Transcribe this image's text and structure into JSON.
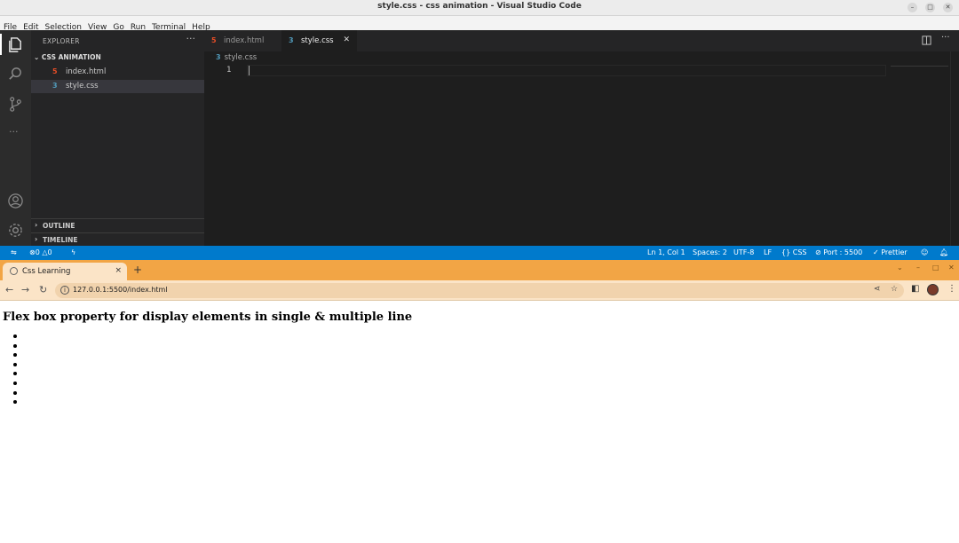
{
  "vscode": {
    "window_title": "style.css - css animation - Visual Studio Code",
    "menu": [
      "File",
      "Edit",
      "Selection",
      "View",
      "Go",
      "Run",
      "Terminal",
      "Help"
    ],
    "explorer": {
      "header": "EXPLORER",
      "more": "···",
      "folder": "CSS ANIMATION",
      "files": [
        {
          "name": "index.html",
          "icon": "html-file-icon",
          "icon_glyph": "5",
          "icon_color": "#e44d26"
        },
        {
          "name": "style.css",
          "icon": "css-file-icon",
          "icon_glyph": "3",
          "icon_color": "#519aba"
        }
      ],
      "outline": "OUTLINE",
      "timeline": "TIMELINE"
    },
    "tabs": [
      {
        "label": "index.html",
        "icon_glyph": "5",
        "icon_color": "#e44d26",
        "active": false
      },
      {
        "label": "style.css",
        "icon_glyph": "3",
        "icon_color": "#519aba",
        "active": true,
        "close": "✕"
      }
    ],
    "breadcrumb": "style.css",
    "breadcrumb_icon": "3",
    "line_number": "1",
    "status": {
      "errors": "0",
      "warnings": "0",
      "position": "Ln 1, Col 1",
      "spaces": "Spaces: 2",
      "encoding": "UTF-8",
      "eol": "LF",
      "language": "CSS",
      "port": "Port : 5500",
      "prettier": "Prettier"
    },
    "colors": {
      "accent": "#007acc",
      "editor_bg": "#1e1e1e",
      "sidebar_bg": "#252526"
    }
  },
  "chrome": {
    "tab_title": "Css Learning",
    "tab_close": "×",
    "new_tab": "+",
    "url": "127.0.0.1:5500/index.html",
    "colors": {
      "frame": "#f2a545",
      "toolbar": "#fbe4c7"
    }
  },
  "webpage": {
    "heading": "Flex box property for display elements in single & multiple line",
    "bullet_count": 8
  }
}
